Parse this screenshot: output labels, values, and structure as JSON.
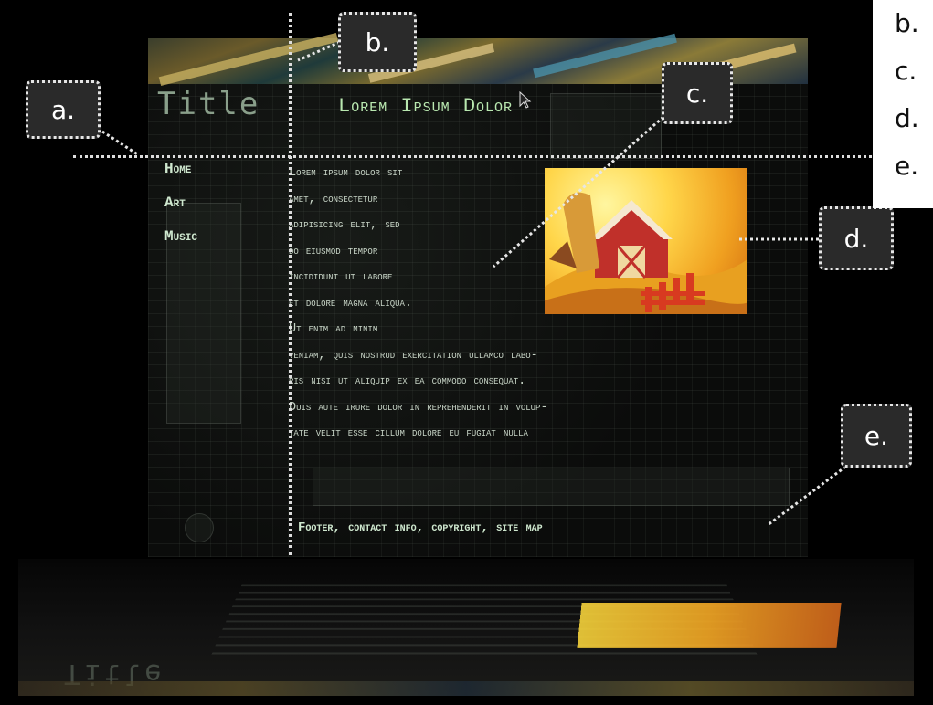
{
  "site": {
    "title": "Title",
    "subtitle": "Lorem Ipsum Dolor",
    "footer": "Footer, contact info, copyright, site map"
  },
  "nav": {
    "items": [
      "Home",
      "Art",
      "Music"
    ]
  },
  "content": {
    "lines": [
      "Lorem ipsum dolor sit",
      "amet, consectetur",
      "adipisicing elit, sed",
      "do eiusmod tempor",
      "incididunt ut labore",
      "et dolore magna aliqua.",
      "Ut enim ad minim",
      "veniam, quis nostrud exercitation ullamco labo-",
      "ris nisi ut aliquip ex ea commodo consequat.",
      "Duis aute irure dolor in reprehenderit in volup-",
      "tate velit esse cillum dolore eu fugiat nulla"
    ]
  },
  "callouts": {
    "a": "a.",
    "b": "b.",
    "c": "c.",
    "d": "d.",
    "e": "e."
  },
  "legend": {
    "items": [
      "b.",
      "c.",
      "d.",
      "e."
    ]
  },
  "colors": {
    "background": "#000000",
    "nav_text": "#cfe8cf",
    "body_text": "#c7d4c6",
    "callout_fill": "#2a2a2a",
    "callout_border": "#e6e6e6"
  }
}
